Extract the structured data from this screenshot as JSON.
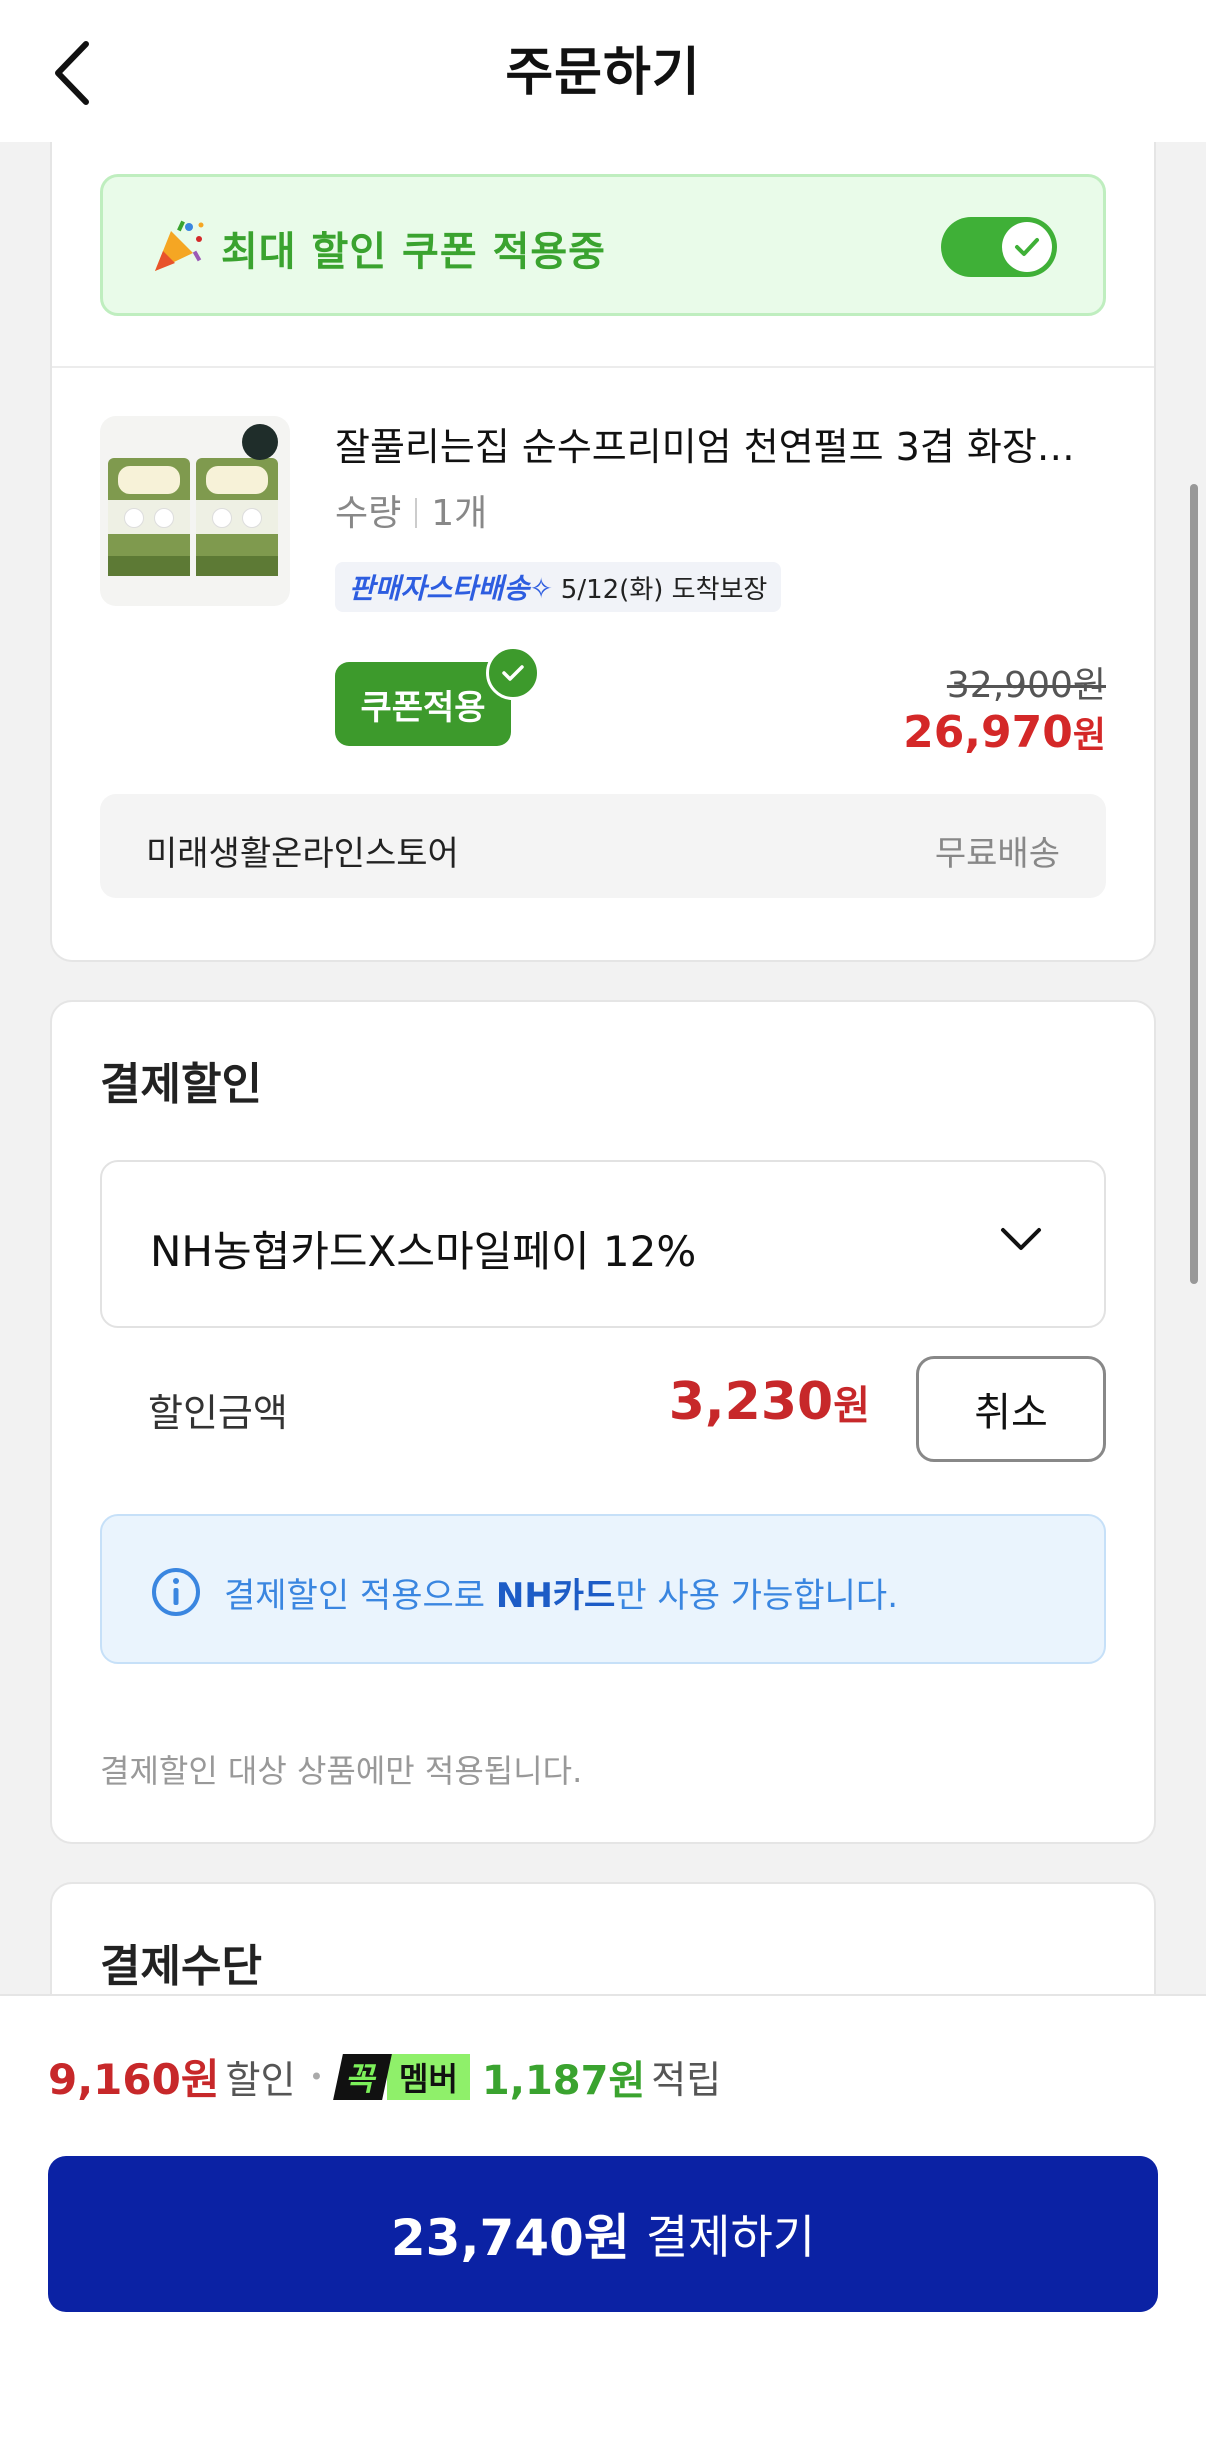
{
  "header": {
    "title": "주문하기"
  },
  "coupon_banner": {
    "text": "최대 할인 쿠폰 적용중",
    "toggle_on": true
  },
  "product": {
    "name": "잘풀리는집 순수프리미엄 천연펄프 3겹 화장…",
    "qty_label": "수량",
    "qty_value": "1개",
    "delivery_badge": "판매자스타배송✧",
    "delivery_date": "5/12(화) 도착보장",
    "coupon_button": "쿠폰적용",
    "original_price": "32,900원",
    "sale_price_num": "26,970",
    "sale_price_unit": "원",
    "seller": "미래생활온라인스토어",
    "shipping": "무료배송"
  },
  "payment_discount": {
    "title": "결제할인",
    "selected_card": "NH농협카드X스마일페이 12%",
    "amount_label": "할인금액",
    "amount_num": "3,230",
    "amount_unit": "원",
    "cancel_button": "취소",
    "info_pre": "결제할인 적용으로 ",
    "info_bold": "NH카드",
    "info_post": "만 사용 가능합니다.",
    "footnote": "결제할인 대상 상품에만 적용됩니다."
  },
  "payment_method": {
    "title": "결제수단"
  },
  "bottom": {
    "discount_num": "9,160원",
    "discount_label": "할인",
    "member_k": "꼭",
    "member_m": "멤버",
    "reward_num": "1,187원",
    "reward_label": "적립",
    "pay_amount": "23,740원",
    "pay_label": "결제하기"
  },
  "colors": {
    "brand_green": "#3fb037",
    "price_red": "#c7282a",
    "pay_blue": "#0b22a4"
  }
}
